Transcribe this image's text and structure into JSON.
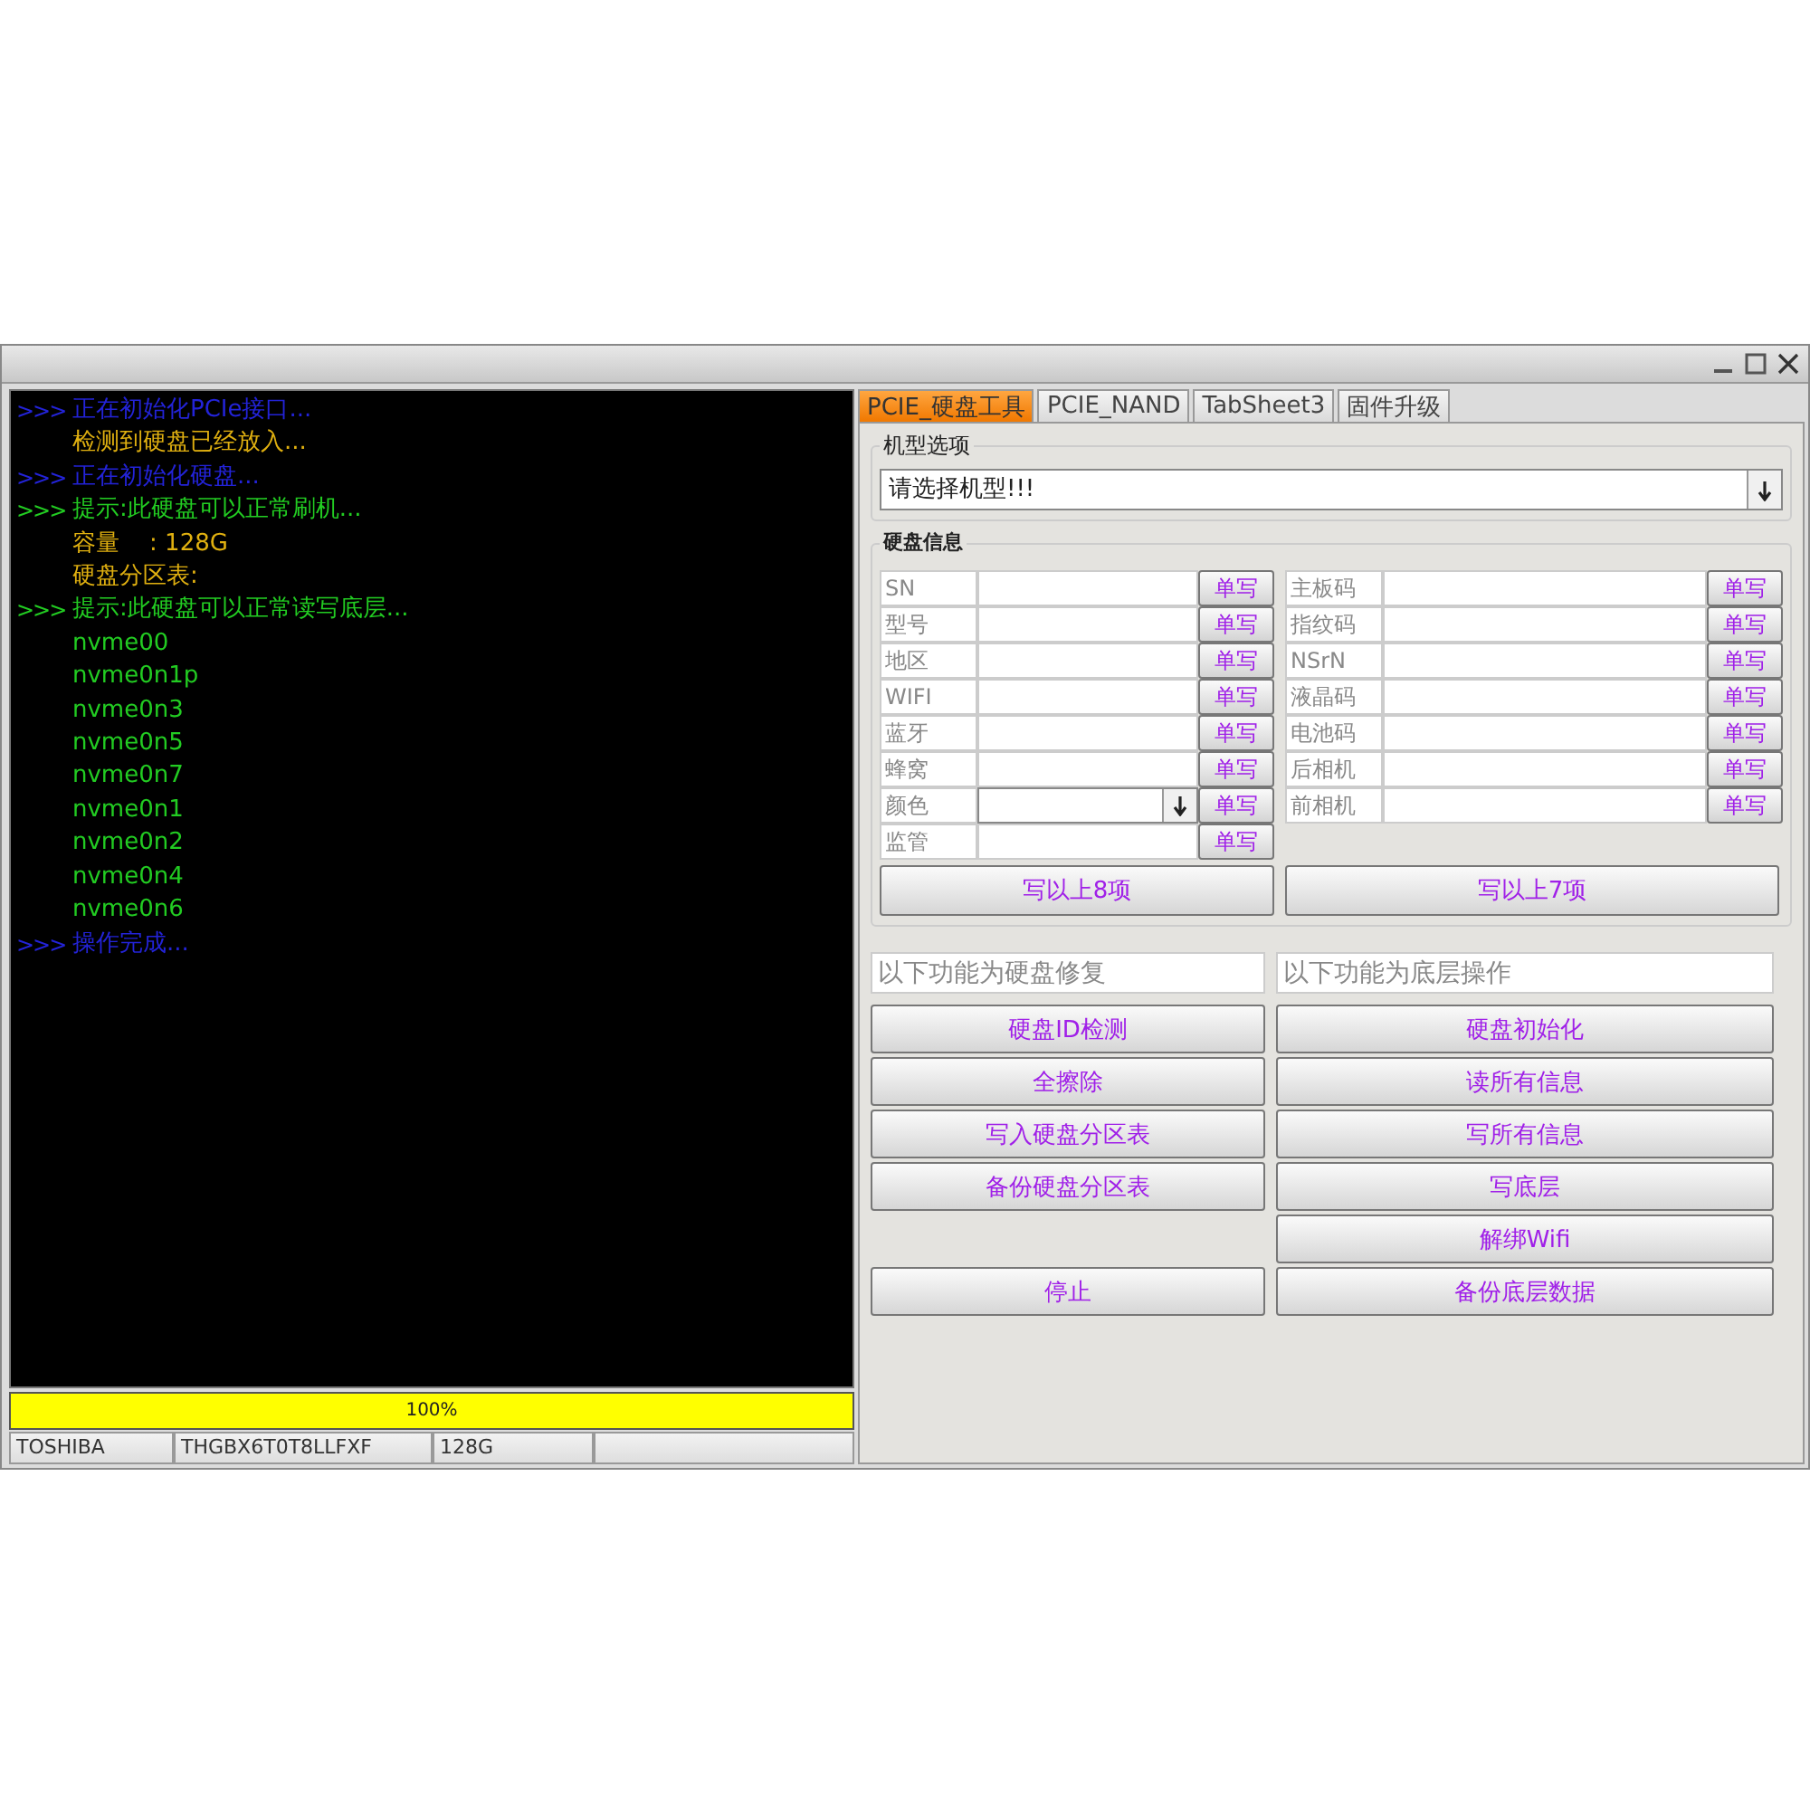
{
  "log": [
    {
      "prefix": ">>>",
      "text": "正在初始化PCIe接口...",
      "color": "#2323d8"
    },
    {
      "text": "检测到硬盘已经放入...",
      "color": "#e0b010"
    },
    {
      "prefix": ">>>",
      "text": "正在初始化硬盘...",
      "color": "#2323d8"
    },
    {
      "prefix": ">>>",
      "text": "提示:此硬盘可以正常刷机...",
      "color": "#22cc22"
    },
    {
      "text": "容量    : 128G",
      "color": "#e0b010"
    },
    {
      "text": "硬盘分区表:",
      "color": "#e0b010"
    },
    {
      "prefix": ">>>",
      "text": "提示:此硬盘可以正常读写底层...",
      "color": "#22cc22"
    },
    {
      "text": "nvme00",
      "color": "#22cc22"
    },
    {
      "text": "nvme0n1p",
      "color": "#22cc22"
    },
    {
      "text": "nvme0n3",
      "color": "#22cc22"
    },
    {
      "text": "nvme0n5",
      "color": "#22cc22"
    },
    {
      "text": "nvme0n7",
      "color": "#22cc22"
    },
    {
      "text": "nvme0n1",
      "color": "#22cc22"
    },
    {
      "text": "nvme0n2",
      "color": "#22cc22"
    },
    {
      "text": "nvme0n4",
      "color": "#22cc22"
    },
    {
      "text": "nvme0n6",
      "color": "#22cc22"
    },
    {
      "prefix": ">>>",
      "text": "操作完成...",
      "color": "#2323d8"
    }
  ],
  "progress": {
    "level": 1,
    "label": "100%"
  },
  "status_bar": [
    "TOSHIBA",
    "THGBX6T0T8LLFXF",
    "128G"
  ],
  "tabs": [
    {
      "label": "PCIE_硬盘工具",
      "selected": true
    },
    {
      "label": "PCIE_NAND",
      "selected": false
    },
    {
      "label": "TabSheet3",
      "selected": false
    },
    {
      "label": "固件升级",
      "selected": false
    }
  ],
  "model_group": {
    "title": "机型选项",
    "combo_value": "请选择机型!!!"
  },
  "disk_info": {
    "title": "硬盘信息",
    "left_rows": [
      {
        "label": "SN",
        "kind": "text",
        "button": "单写"
      },
      {
        "label": "型号",
        "kind": "text",
        "button": "单写"
      },
      {
        "label": "地区",
        "kind": "text",
        "button": "单写"
      },
      {
        "label": "WIFI",
        "kind": "text",
        "button": "单写"
      },
      {
        "label": "蓝牙",
        "kind": "text",
        "button": "单写"
      },
      {
        "label": "蜂窝",
        "kind": "text",
        "button": "单写"
      },
      {
        "label": "颜色",
        "kind": "combo",
        "button": "单写"
      },
      {
        "label": "监管",
        "kind": "text",
        "button": "单写"
      }
    ],
    "right_rows": [
      {
        "label": "主板码",
        "kind": "text",
        "button": "单写"
      },
      {
        "label": "指纹码",
        "kind": "text",
        "button": "单写"
      },
      {
        "label": "NSrN",
        "kind": "text",
        "button": "单写"
      },
      {
        "label": "液晶码",
        "kind": "text",
        "button": "单写"
      },
      {
        "label": "电池码",
        "kind": "text",
        "button": "单写"
      },
      {
        "label": "后相机",
        "kind": "text",
        "button": "单写"
      },
      {
        "label": "前相机",
        "kind": "text",
        "button": "单写"
      }
    ],
    "write_buttons": [
      "写以上8项",
      "写以上7项"
    ]
  },
  "actions": {
    "left": {
      "header": "以下功能为硬盘修复",
      "buttons": [
        "硬盘ID检测",
        "全擦除",
        "写入硬盘分区表",
        "备份硬盘分区表"
      ],
      "stop_button": "停止"
    },
    "right": {
      "header": "以下功能为底层操作",
      "buttons": [
        "硬盘初始化",
        "读所有信息",
        "写所有信息",
        "写底层",
        "解绑Wifi",
        "备份底层数据"
      ]
    }
  }
}
